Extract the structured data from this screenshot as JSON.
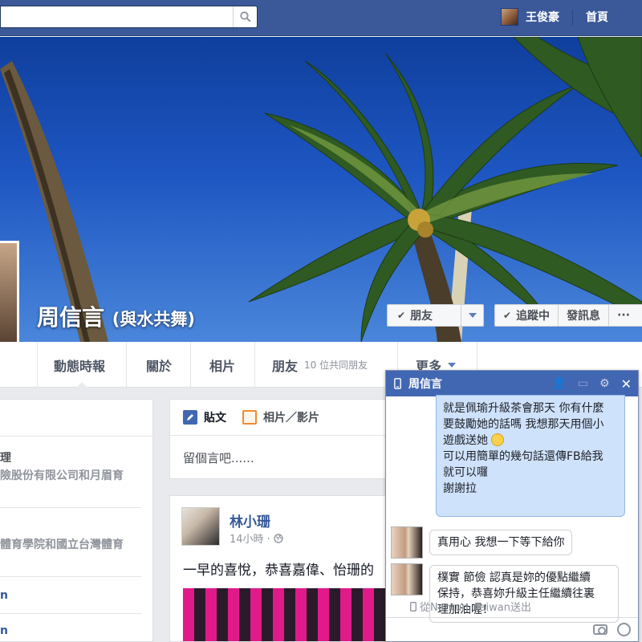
{
  "topbar": {
    "user_name": "王俊豪",
    "home_label": "首頁",
    "search_icon": "search-icon"
  },
  "profile": {
    "name": "周信言",
    "alt_name": "(與水共舞)",
    "buttons": {
      "friend": "朋友",
      "following": "追蹤中",
      "message": "發訊息",
      "more": "···"
    }
  },
  "nav": {
    "tabs": [
      {
        "label": "動態時報"
      },
      {
        "label": "關於"
      },
      {
        "label": "相片"
      },
      {
        "label": "朋友",
        "sub": "10 位共同朋友"
      },
      {
        "label": "更多"
      }
    ]
  },
  "left_column": {
    "lines": [
      "理",
      "險股份有限公司和月眉育",
      "體育學院和國立台灣體育",
      "n",
      "n"
    ]
  },
  "composer": {
    "post_tab": "貼文",
    "photo_tab": "相片／影片",
    "placeholder": "留個言吧......"
  },
  "post": {
    "author": "林小珊",
    "time": "14小時 · ",
    "text": "一早的喜悅，恭喜嘉偉、怡珊的"
  },
  "chat": {
    "contact_name": "周信言",
    "my_message_lines": [
      "就是佩瑜升級茶會那天 你有什麼",
      "要鼓勵她的話嗎 我想那天用個小",
      "遊戲送她",
      "可以用簡單的幾句話還傳FB給我",
      "就可以囉",
      "謝謝拉"
    ],
    "reply_1": "真用心 我想一下等下給你",
    "reply_2_lines": [
      "樸實 節儉 認真是妳的優點繼續",
      "保持，恭喜妳升級主任繼續往裏",
      "理加油喔！"
    ],
    "sent_from": "從Nantun, Taiwan送出"
  }
}
